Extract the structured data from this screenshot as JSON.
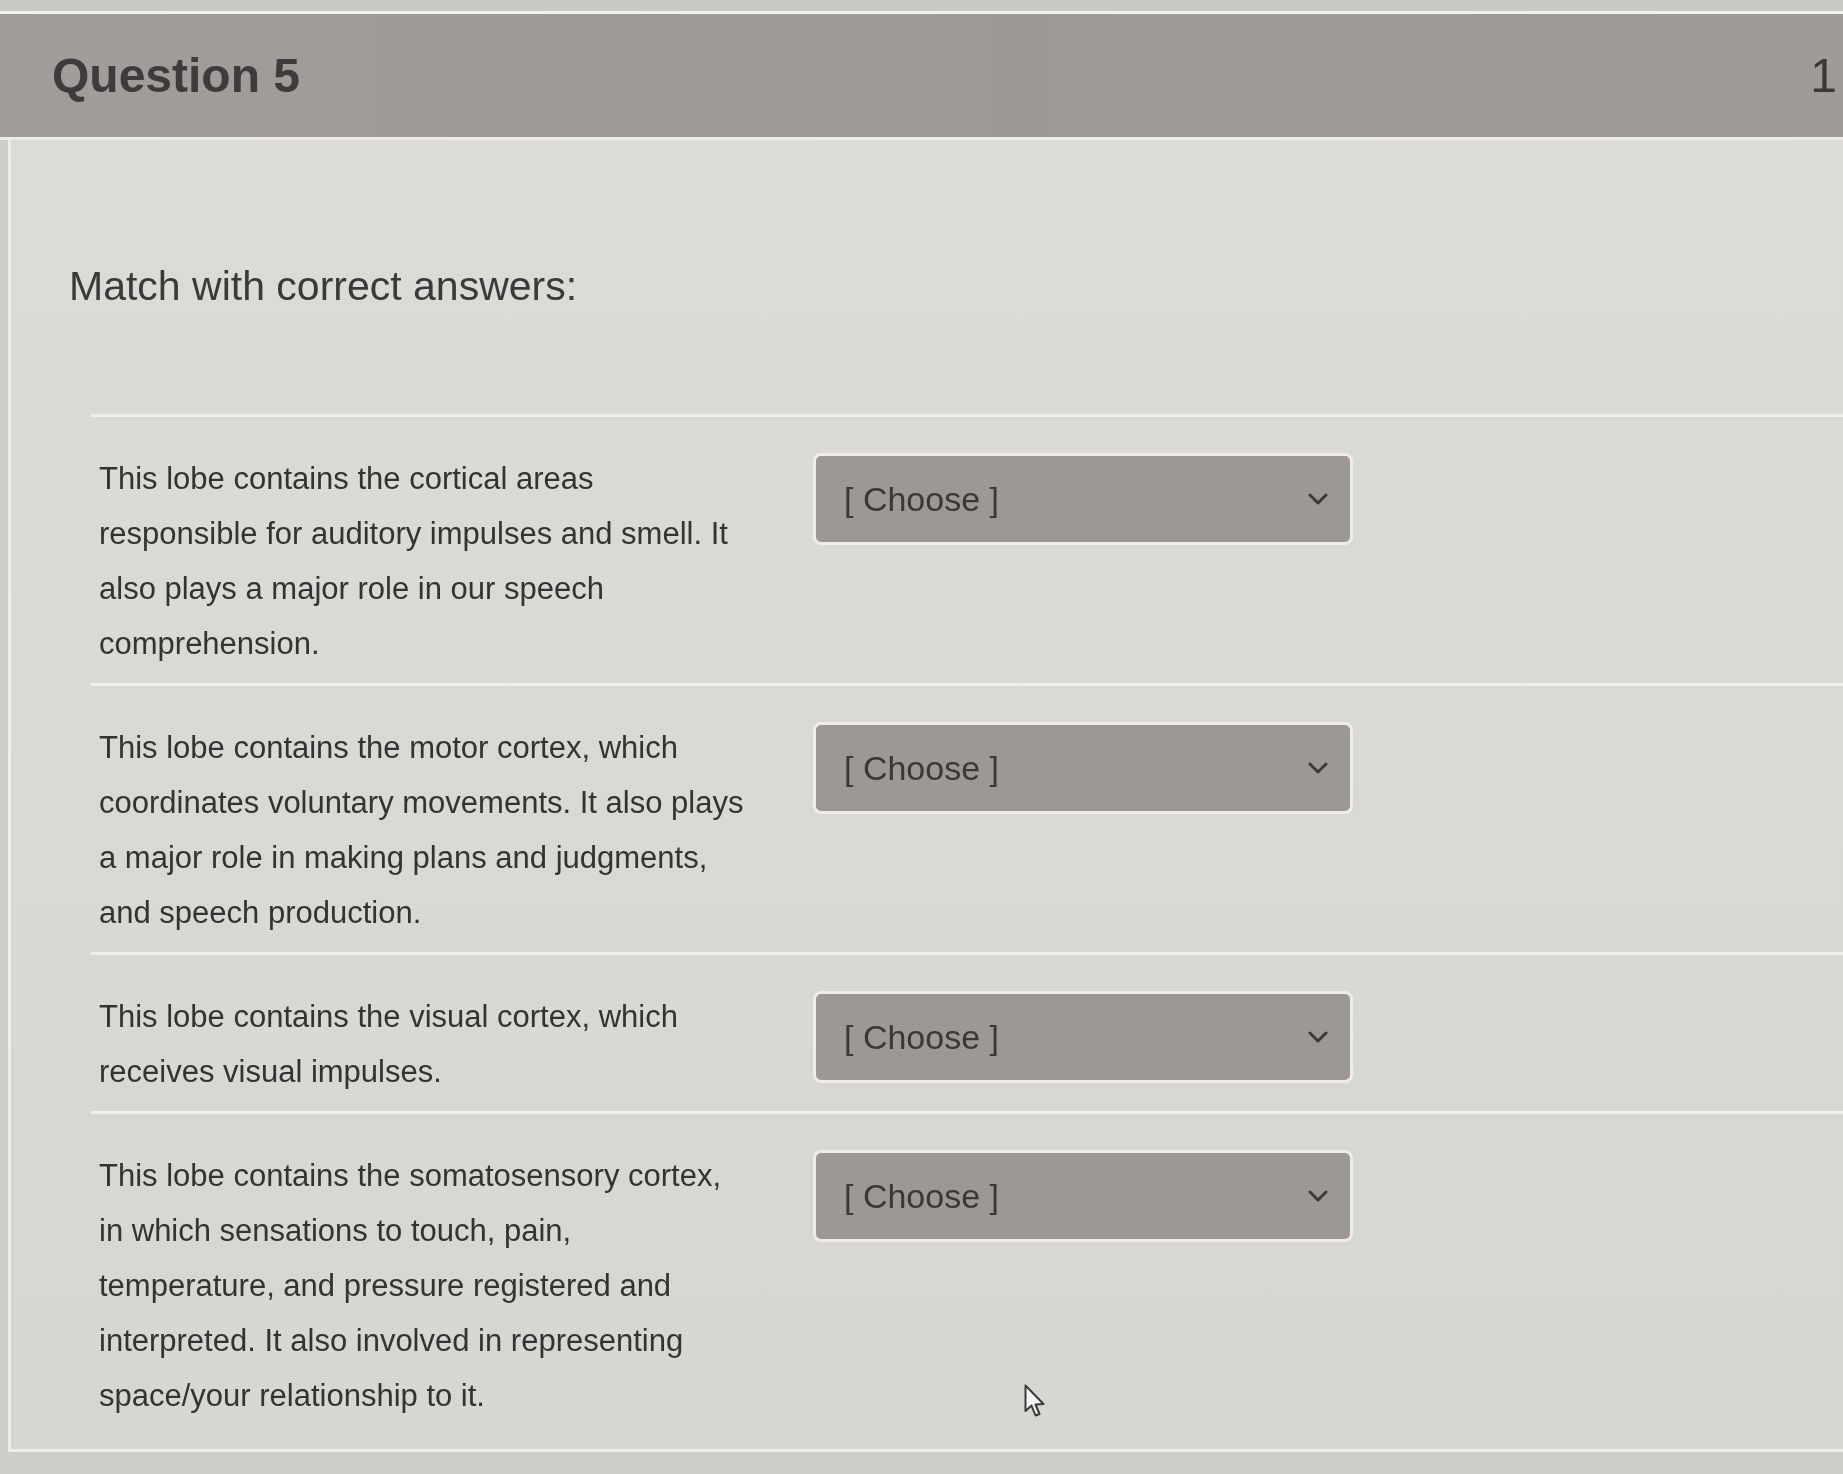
{
  "question": {
    "title": "Question 5",
    "points": "1"
  },
  "prompt": "Match with correct answers:",
  "matches": [
    {
      "description": "This lobe contains the cortical areas responsible for auditory impulses and smell. It also plays a major role in our speech comprehension.",
      "selection": "[ Choose ]"
    },
    {
      "description": "This lobe contains the motor cortex, which coordinates voluntary movements. It also plays a major role in making plans and judgments, and speech production.",
      "selection": "[ Choose ]"
    },
    {
      "description": "This lobe contains the visual cortex, which receives visual impulses.",
      "selection": "[ Choose ]"
    },
    {
      "description": "This lobe contains the somatosensory cortex, in which sensations to touch, pain, temperature, and pressure registered and interpreted. It also involved in representing space/your relationship to it.",
      "selection": "[ Choose ]"
    }
  ]
}
